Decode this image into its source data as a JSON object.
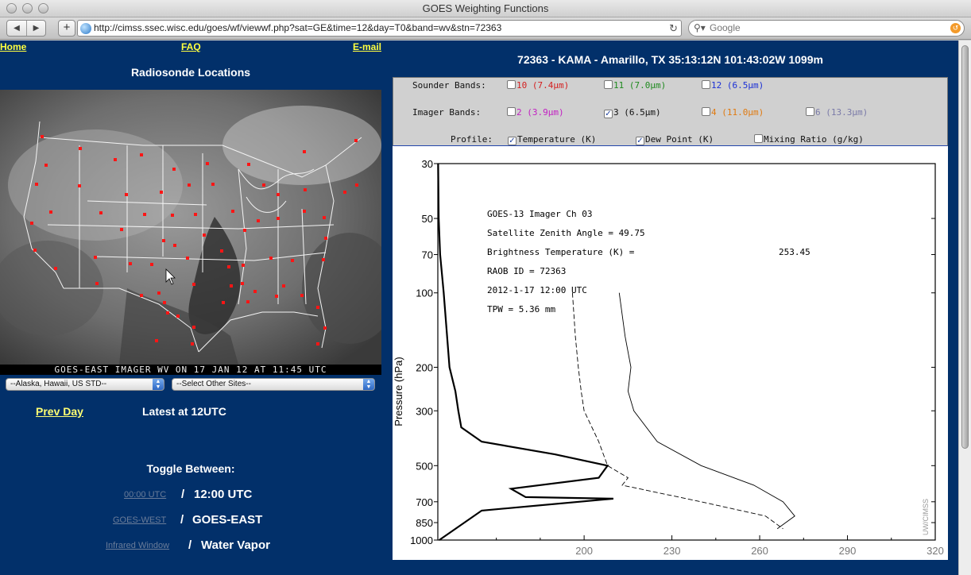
{
  "window": {
    "title": "GOES Weighting Functions",
    "url": "http://cimss.ssec.wisc.edu/goes/wf/viewwf.php?sat=GE&time=12&day=T0&band=wv&stn=72363",
    "search_placeholder": "Google"
  },
  "nav": {
    "home": "Home",
    "faq": "FAQ",
    "email": "E-mail"
  },
  "left": {
    "map_title": "Radiosonde Locations",
    "map_caption": "GOES-EAST IMAGER WV ON 17 JAN 12 AT 11:45 UTC",
    "select_alaska": "--Alaska, Hawaii, US STD--",
    "select_other": "--Select Other Sites--",
    "prev_day": "Prev Day",
    "latest": "Latest at 12UTC",
    "toggle_title": "Toggle Between:",
    "toggle_time_link": "00:00 UTC",
    "toggle_time_current": "12:00 UTC",
    "toggle_sat_link": "GOES-WEST",
    "toggle_sat_current": "GOES-EAST",
    "toggle_band_link": "Infrared Window",
    "toggle_band_current": "Water Vapor",
    "separator": "/"
  },
  "station_title": "72363 - KAMA - Amarillo, TX 35:13:12N 101:43:02W 1099m",
  "bands": {
    "sounder_label": "Sounder Bands:",
    "imager_label": "Imager  Bands:",
    "profile_label": "Profile:",
    "sounder": [
      {
        "label": "10 (7.4μm)",
        "color": "#d42020",
        "checked": false
      },
      {
        "label": "11 (7.0μm)",
        "color": "#1f8a1f",
        "checked": false
      },
      {
        "label": "12 (6.5μm)",
        "color": "#1a2fd6",
        "checked": false
      }
    ],
    "imager": [
      {
        "label": "2 (3.9μm)",
        "color": "#c21ec2",
        "checked": false
      },
      {
        "label": "3 (6.5μm)",
        "color": "#111111",
        "checked": true
      },
      {
        "label": "4 (11.0μm)",
        "color": "#e07a10",
        "checked": false
      },
      {
        "label": "6 (13.3μm)",
        "color": "#7a7aa8",
        "checked": false
      }
    ],
    "profile": [
      {
        "label": "Temperature (K)",
        "checked": true
      },
      {
        "label": "Dew Point (K)",
        "checked": true
      },
      {
        "label": "Mixing Ratio (g/kg)",
        "checked": false
      }
    ]
  },
  "chart_data": {
    "type": "line",
    "ylabel": "Pressure (hPa)",
    "y_scale": "log",
    "y_reversed": true,
    "ylim": [
      1000,
      30
    ],
    "y_ticks": [
      30,
      50,
      70,
      100,
      200,
      300,
      500,
      700,
      850,
      1000
    ],
    "x_ticks": [
      200,
      230,
      260,
      290,
      320
    ],
    "xlim": [
      150,
      320
    ],
    "annotations": [
      "GOES-13 Imager  Ch     03",
      "Satellite Zenith Angle = 49.75",
      "Brightness Temperature (K) =",
      "253.45",
      "RAOB ID = 72363",
      "2012-1-17 12:00 UTC",
      "TPW = 5.36 mm"
    ],
    "watermark": "UW/CIMSS",
    "series": [
      {
        "id": "weighting",
        "style": "solid-bold",
        "x": [
          150.1,
          150.3,
          150.8,
          152,
          154,
          156,
          157,
          158,
          165,
          190,
          208,
          205,
          175,
          180,
          210,
          165,
          150.5
        ],
        "y": [
          30,
          50,
          70,
          100,
          200,
          250,
          300,
          350,
          400,
          450,
          500,
          560,
          620,
          670,
          680,
          760,
          1000
        ]
      },
      {
        "id": "temperature",
        "style": "solid-thin",
        "x": [
          212,
          214,
          216,
          215,
          217,
          225,
          240,
          258,
          268,
          272,
          266
        ],
        "y": [
          100,
          150,
          200,
          250,
          300,
          400,
          500,
          600,
          700,
          800,
          900
        ]
      },
      {
        "id": "dewpoint",
        "style": "dashed",
        "x": [
          196,
          197,
          198,
          199,
          200,
          205,
          208,
          215,
          213,
          240,
          262,
          268
        ],
        "y": [
          100,
          150,
          200,
          250,
          300,
          400,
          500,
          560,
          600,
          700,
          800,
          900
        ]
      }
    ]
  },
  "colors": {
    "page_bg": "#02306a",
    "link": "#ffff40",
    "panel_bg": "#d0d0d0"
  }
}
